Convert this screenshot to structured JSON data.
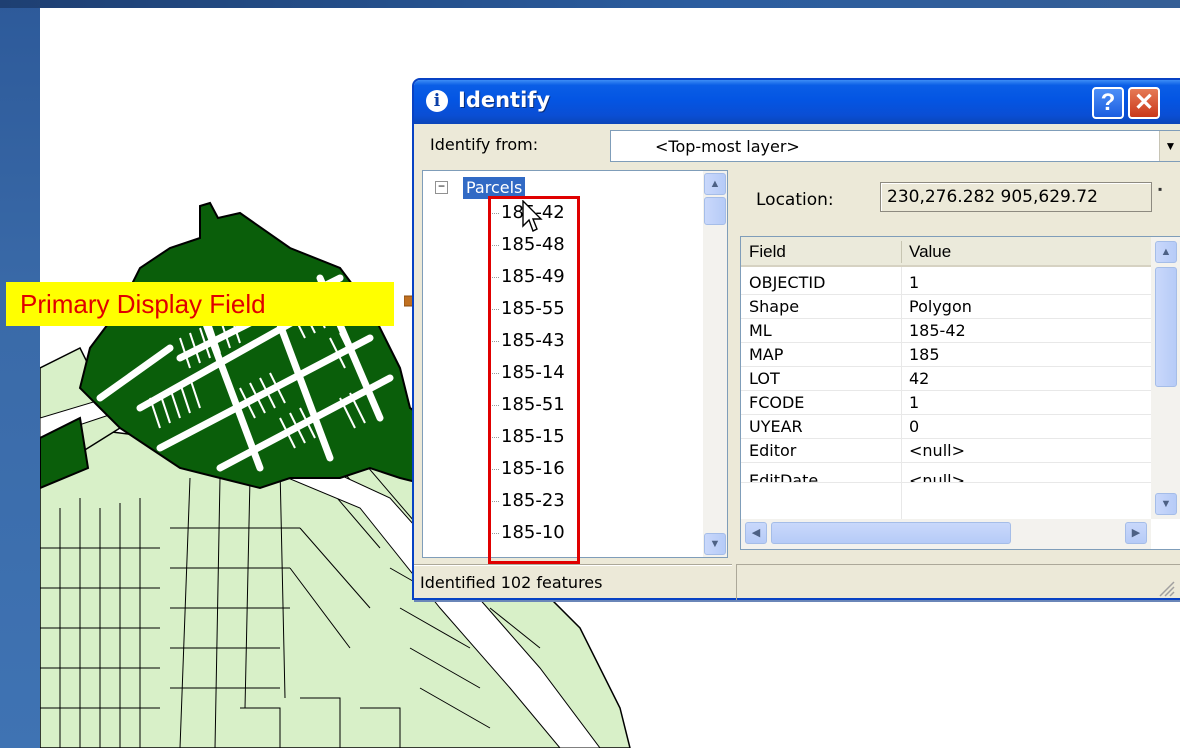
{
  "callout": {
    "text": "Primary Display Field",
    "bg_color": "#ffff00",
    "text_color": "#e00000"
  },
  "map": {
    "selected_fill": "#0a5e0a",
    "parcel_fill": "#d8f0c8",
    "outline": "#000000"
  },
  "identify_window": {
    "title": "Identify",
    "title_icon": "info-icon",
    "help_label": "?",
    "close_label": "✕",
    "identify_from_label": "Identify from:",
    "identify_from_value": "<Top-most layer>",
    "tree": {
      "root_label": "Parcels",
      "items": [
        "185-42",
        "185-48",
        "185-49",
        "185-55",
        "185-43",
        "185-14",
        "185-51",
        "185-15",
        "185-16",
        "185-23",
        "185-10"
      ]
    },
    "location_label": "Location:",
    "location_value": "230,276.282  905,629.72",
    "attributes": {
      "headers": [
        "Field",
        "Value"
      ],
      "rows": [
        {
          "field": "OBJECTID",
          "value": "1"
        },
        {
          "field": "Shape",
          "value": "Polygon"
        },
        {
          "field": "ML",
          "value": "185-42"
        },
        {
          "field": "MAP",
          "value": "185"
        },
        {
          "field": "LOT",
          "value": "42"
        },
        {
          "field": "FCODE",
          "value": "1"
        },
        {
          "field": "UYEAR",
          "value": "0"
        },
        {
          "field": "Editor",
          "value": "<null>"
        },
        {
          "field": "EditDate",
          "value": "<null>"
        }
      ]
    },
    "status_text": "Identified 102 features"
  },
  "colors": {
    "selection_highlight": "#316ac5",
    "titlebar_blue": "#0455e3",
    "highlight_box": "#e00000"
  }
}
